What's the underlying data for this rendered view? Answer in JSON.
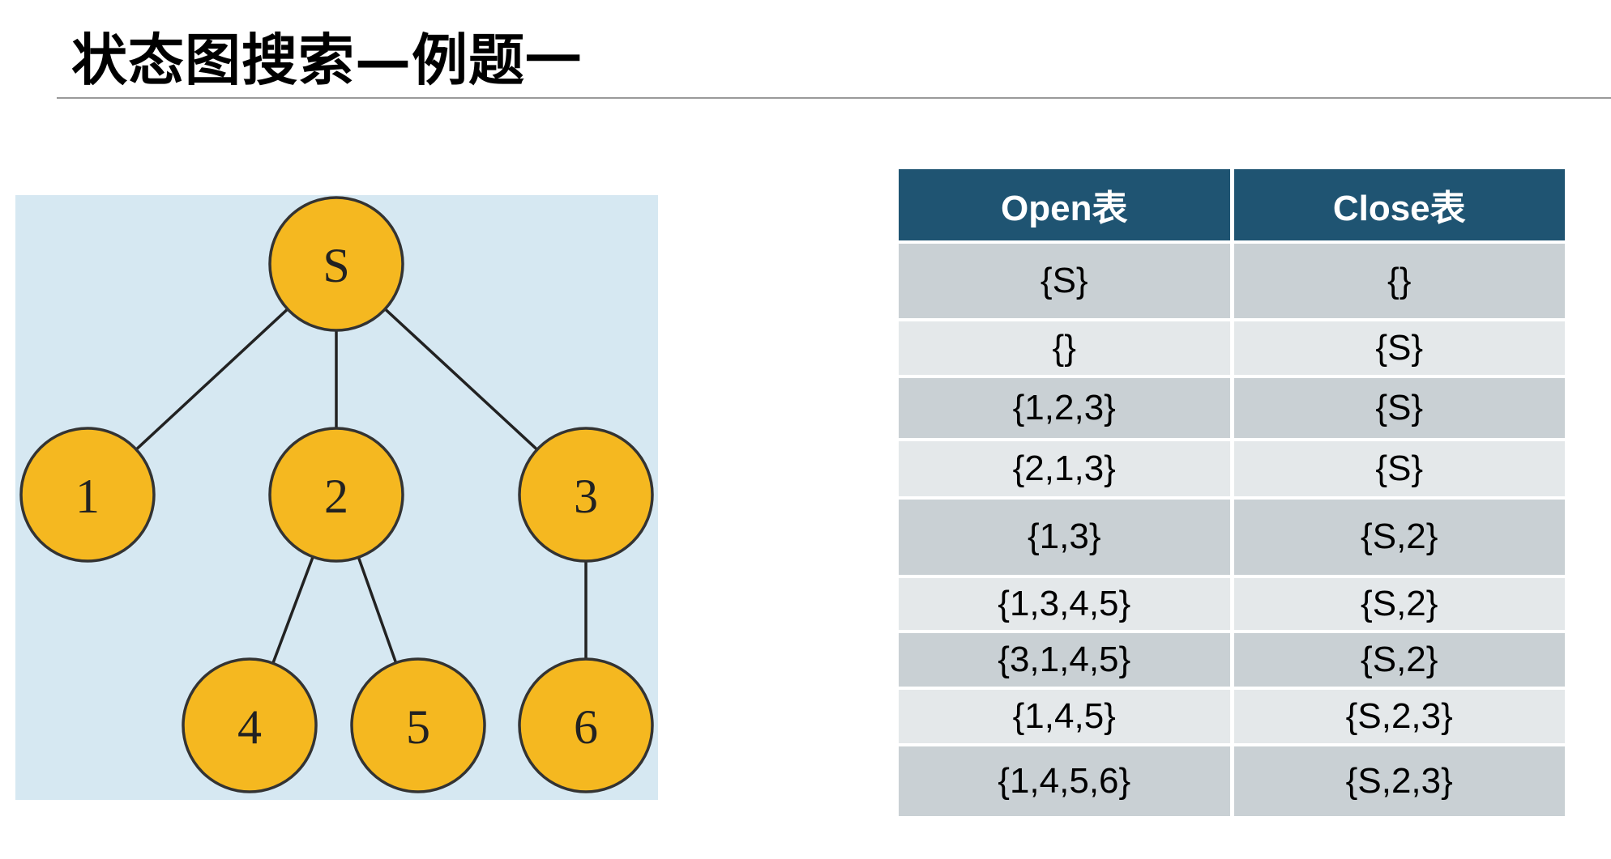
{
  "title": "状态图搜索—例题一",
  "tree": {
    "nodes": [
      {
        "id": "S",
        "label": "S"
      },
      {
        "id": "1",
        "label": "1"
      },
      {
        "id": "2",
        "label": "2"
      },
      {
        "id": "3",
        "label": "3"
      },
      {
        "id": "4",
        "label": "4"
      },
      {
        "id": "5",
        "label": "5"
      },
      {
        "id": "6",
        "label": "6"
      }
    ],
    "edges": [
      {
        "from": "S",
        "to": "1"
      },
      {
        "from": "S",
        "to": "2"
      },
      {
        "from": "S",
        "to": "3"
      },
      {
        "from": "2",
        "to": "4"
      },
      {
        "from": "2",
        "to": "5"
      },
      {
        "from": "3",
        "to": "6"
      }
    ],
    "colors": {
      "background": "#d6e8f2",
      "node_fill": "#f5b820",
      "node_stroke": "#333333",
      "edge": "#222222",
      "label": "#222222"
    }
  },
  "table": {
    "headers": [
      "Open表",
      "Close表"
    ],
    "rows": [
      [
        "{S}",
        "{}"
      ],
      [
        "{}",
        "{S}"
      ],
      [
        "{1,2,3}",
        "{S}"
      ],
      [
        "{2,1,3}",
        "{S}"
      ],
      [
        "{1,3}",
        "{S,2}"
      ],
      [
        "{1,3,4,5}",
        "{S,2}"
      ],
      [
        "{3,1,4,5}",
        "{S,2}"
      ],
      [
        "{1,4,5}",
        "{S,2,3}"
      ],
      [
        "{1,4,5,6}",
        "{S,2,3}"
      ]
    ],
    "colors": {
      "header": "#1f5472",
      "row_dark": "#c9d0d4",
      "row_light": "#e4e8ea"
    }
  }
}
